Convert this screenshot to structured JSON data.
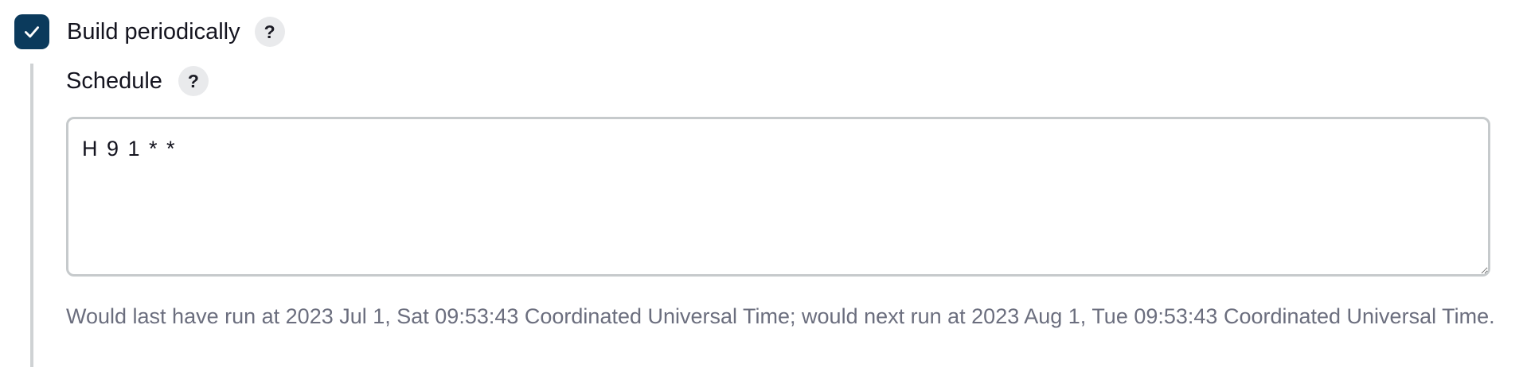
{
  "trigger": {
    "checkbox_label": "Build periodically",
    "checked": true,
    "help_symbol": "?"
  },
  "schedule": {
    "label": "Schedule",
    "help_symbol": "?",
    "value": "H 9 1 * *",
    "hint": "Would last have run at 2023 Jul 1, Sat 09:53:43 Coordinated Universal Time; would next run at 2023 Aug 1, Tue 09:53:43 Coordinated Universal Time."
  },
  "colors": {
    "checkbox_fill": "#0b3a5c",
    "help_bg": "#e9eaec",
    "border": "#c6cacc",
    "hint_text": "#6b6e7e"
  },
  "icons": {
    "checkbox": "check-icon",
    "help": "question-mark-icon",
    "resize": "resize-grip-icon"
  }
}
